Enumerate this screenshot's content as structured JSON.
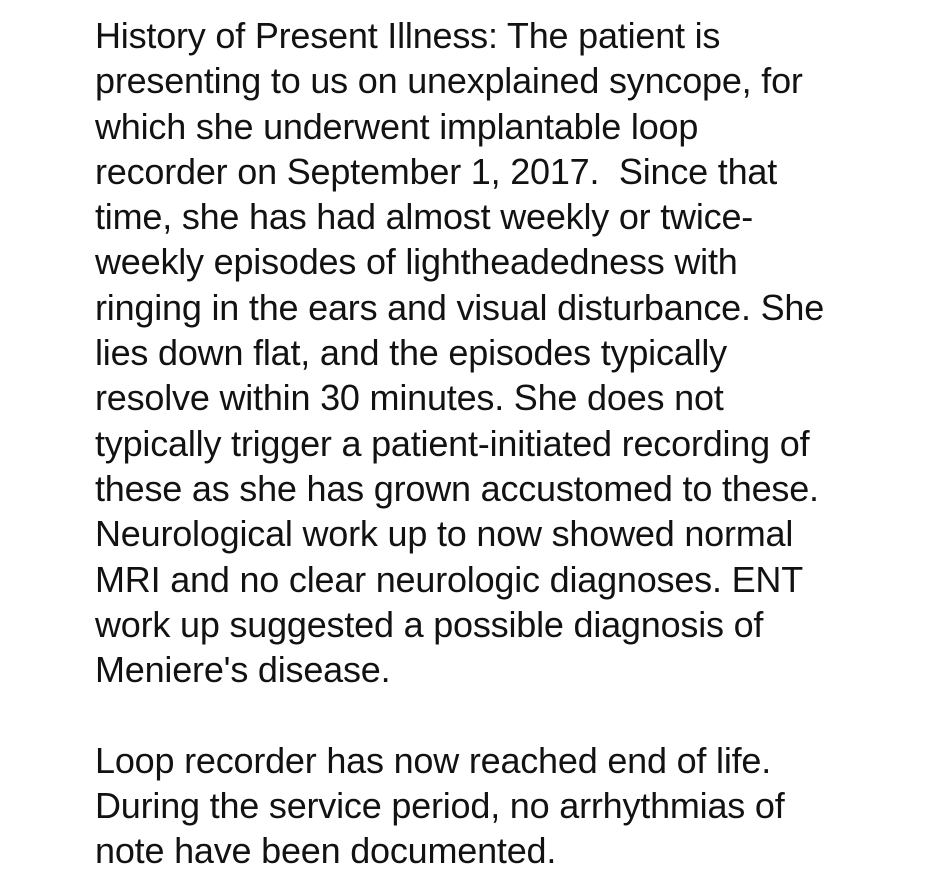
{
  "note": {
    "paragraph1_lines": [
      "History of Present Illness: The patient is",
      "presenting to us on unexplained syncope, for",
      "which she underwent implantable loop",
      "recorder on September 1, 2017.  Since that",
      "time, she has had almost weekly or twice-",
      "weekly episodes of lightheadedness with",
      "ringing in the ears and visual disturbance. She",
      "lies down flat, and the episodes typically",
      "resolve within 30 minutes. She does not",
      "typically trigger a patient-initiated recording of",
      "these as she has grown accustomed to these.",
      "Neurological work up to now showed normal",
      "MRI and no clear neurologic diagnoses. ENT",
      "work up suggested a possible diagnosis of",
      "Meniere's disease."
    ],
    "paragraph2_lines": [
      "Loop recorder has now reached end of life.",
      "During the service period, no arrhythmias of",
      "note have been documented."
    ]
  }
}
